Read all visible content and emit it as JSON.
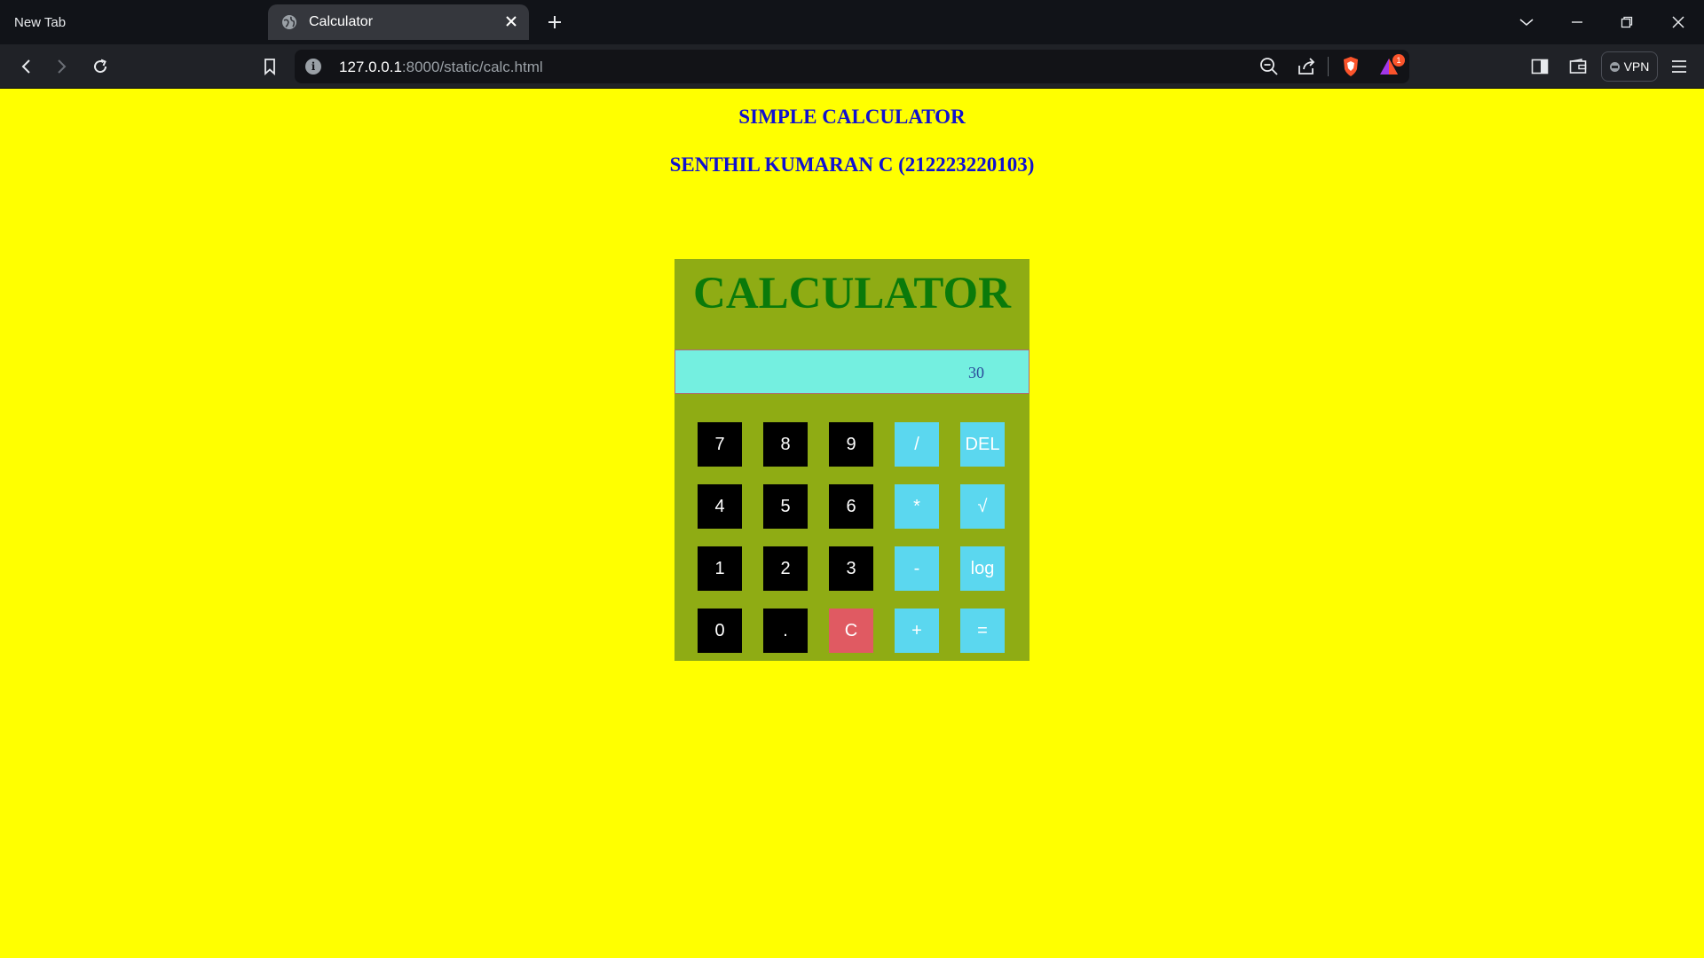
{
  "browser": {
    "tabs": [
      {
        "label": "New Tab",
        "active": false
      },
      {
        "label": "Calculator",
        "active": true
      }
    ],
    "url_host": "127.0.0.1",
    "url_rest": ":8000/static/calc.html",
    "alert_count": "1",
    "vpn_label": "VPN",
    "icons": [
      "globe-icon",
      "close-icon",
      "plus-icon",
      "chevron-down-icon",
      "minimize-icon",
      "restore-icon",
      "window-close-icon",
      "back-icon",
      "forward-icon",
      "reload-icon",
      "bookmark-icon",
      "info-icon",
      "zoom-out-icon",
      "share-icon",
      "brave-shield-icon",
      "brave-rewards-icon",
      "sidebar-icon",
      "wallet-icon",
      "menu-icon"
    ]
  },
  "page": {
    "heading": "SIMPLE CALCULATOR",
    "subheading": "SENTHIL KUMARAN C (212223220103)",
    "background": "#ffff00"
  },
  "calculator": {
    "title": "CALCULATOR",
    "display_value": "30",
    "colors": {
      "body": "#8fac14",
      "display": "#74efe0",
      "number_key": "#000000",
      "operator_key": "#5bd7ef",
      "clear_key": "#e05a62",
      "title": "#0a7a0a"
    },
    "keys": [
      [
        "7",
        "8",
        "9",
        "/",
        "DEL"
      ],
      [
        "4",
        "5",
        "6",
        "*",
        "√"
      ],
      [
        "1",
        "2",
        "3",
        "-",
        "log"
      ],
      [
        "0",
        ".",
        "C",
        "+",
        "="
      ]
    ]
  }
}
